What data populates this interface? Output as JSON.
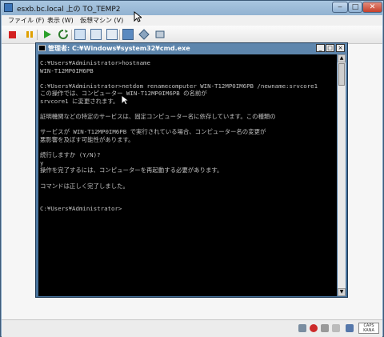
{
  "window": {
    "title": "esxb.bc.local 上の TO_TEMP2"
  },
  "menubar": [
    {
      "label": "ファイル (F)"
    },
    {
      "label": "表示 (W)"
    },
    {
      "label": "仮想マシン (V)"
    }
  ],
  "toolbar": {
    "icons": [
      "stop-icon",
      "pause-icon",
      "play-icon",
      "reset-icon",
      "snapshot-icon",
      "revert-snapshot-icon",
      "manage-snapshots-icon",
      "console-icon",
      "vm-settings-icon",
      "network-icon"
    ]
  },
  "cmd": {
    "title": "管理者: C:¥Windows¥system32¥cmd.exe",
    "lines": [
      "C:¥Users¥Administrator>hostname",
      "WIN-T12MP0IM6PB",
      "",
      "C:¥Users¥Administrator>netdom renamecomputer WIN-T12MP0IM6PB /newname:srvcore1",
      "この操作では、コンピューター WIN-T12MP0IM6PB の名前が",
      "srvcore1 に変更されます。",
      "",
      "証明機関などの特定のサービスは、固定コンピューター名に依存しています。この種類の",
      "",
      "サービスが WIN-T12MP0IM6PB で実行されている場合、コンピューター名の変更が",
      "悪影響を及ぼす可能性があります。",
      "",
      "続行しますか (Y/N)?",
      "y",
      "操作を完了するには、コンピューターを再起動する必要があります。",
      "",
      "コマンドは正しく完了しました。",
      "",
      "",
      "C:¥Users¥Administrator>"
    ]
  },
  "statusbar": {
    "ime_top": "CAPS",
    "ime_bottom": "KANA"
  },
  "colors": {
    "console_bg": "#000000",
    "console_fg": "#c0c0c0",
    "close_red": "#c6402b"
  }
}
